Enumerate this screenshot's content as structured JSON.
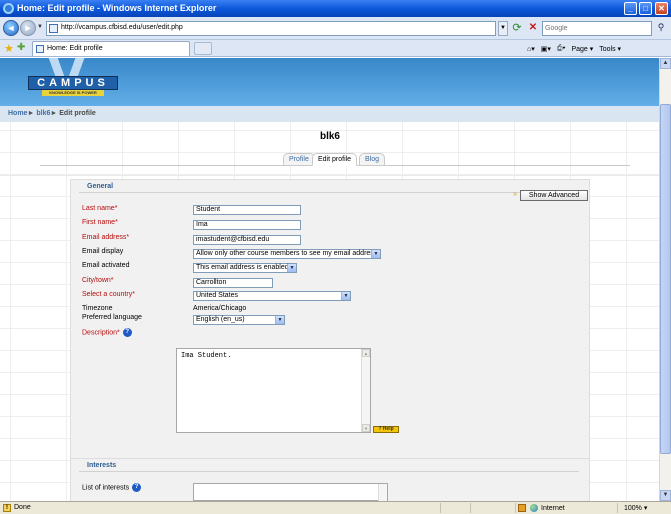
{
  "browser": {
    "window_title": "Home: Edit profile - Windows Internet Explorer",
    "address": "http://vcampus.cfbisd.edu/user/edit.php",
    "search_placeholder": "Google",
    "tab_title": "Home: Edit profile",
    "commands": [
      "Page",
      "Tools"
    ],
    "icons": [
      "ie-logo-icon",
      "back-icon",
      "forward-icon",
      "refresh-icon",
      "stop-icon",
      "search-icon",
      "favorites-star-icon",
      "add-favorites-icon",
      "home-icon",
      "feeds-icon",
      "print-icon"
    ]
  },
  "site": {
    "logo_text": "CAMPUS",
    "logo_letter": "V",
    "logo_slogan": "KNOWLEDGE IS POWER",
    "breadcrumb": {
      "home": "Home",
      "course": "blk6",
      "current": "Edit profile",
      "separator": "►"
    },
    "user_title": "blk6",
    "tabs": [
      {
        "label": "Profile",
        "active": false
      },
      {
        "label": "Edit profile",
        "active": true
      },
      {
        "label": "Blog",
        "active": false
      }
    ]
  },
  "form": {
    "general_legend": "General",
    "show_advanced_label": "Show Advanced",
    "required_mark": "*",
    "fields": {
      "last_name": {
        "label": "Last name",
        "value": "Student",
        "required": true
      },
      "first_name": {
        "label": "First name",
        "value": "Ima",
        "required": true
      },
      "email": {
        "label": "Email address",
        "value": "imastudent@cfbisd.edu",
        "required": true
      },
      "email_display": {
        "label": "Email display",
        "value": "Allow only other course members to see my email address"
      },
      "email_activated": {
        "label": "Email activated",
        "value": "This email address is enabled"
      },
      "city": {
        "label": "City/town",
        "value": "Carrollton",
        "required": true
      },
      "country": {
        "label": "Select a country",
        "value": "United States",
        "required": true
      },
      "timezone": {
        "label": "Timezone",
        "value": "America/Chicago"
      },
      "language": {
        "label": "Preferred language",
        "value": "English (en_us)"
      },
      "description": {
        "label": "Description",
        "value": "Ima Student.",
        "required": true
      }
    },
    "editor_badge": "? Help",
    "interests_legend": "Interests",
    "interests_label": "List of interests"
  },
  "statusbar": {
    "status": "Done",
    "zone": "Internet",
    "zoom": "100%"
  },
  "colors": {
    "titlebar": "#0b56d8",
    "banner": "#3887c8",
    "breadcrumb_bg": "#d9e6f2",
    "link": "#3c6aa1",
    "required": "#b50c0c",
    "legend": "#2f5d92"
  }
}
